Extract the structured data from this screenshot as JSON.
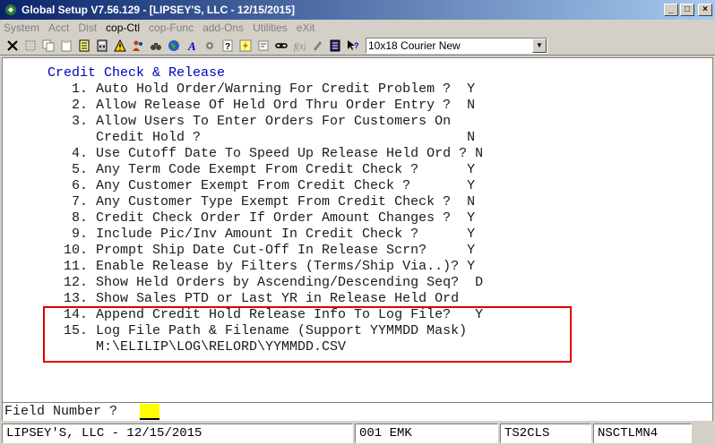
{
  "window": {
    "title": "Global Setup V7.56.129 - [LIPSEY'S, LLC - 12/15/2015]",
    "minimize": "_",
    "maximize": "□",
    "close": "×"
  },
  "menu": [
    {
      "label": "System",
      "enabled": false
    },
    {
      "label": "Acct",
      "enabled": false
    },
    {
      "label": "Dist",
      "enabled": false
    },
    {
      "label": "cop-Ctl",
      "enabled": true
    },
    {
      "label": "cop-Func",
      "enabled": false
    },
    {
      "label": "add-Ons",
      "enabled": false
    },
    {
      "label": "Utilities",
      "enabled": false
    },
    {
      "label": "eXit",
      "enabled": false
    }
  ],
  "toolbar": {
    "font_select": "10x18 Courier New"
  },
  "screen": {
    "title": "Credit Check & Release",
    "lines": [
      {
        "text": "   1. Auto Hold Order/Warning For Credit Problem ?  Y"
      },
      {
        "text": "   2. Allow Release Of Held Ord Thru Order Entry ?  N"
      },
      {
        "text": "   3. Allow Users To Enter Orders For Customers On"
      },
      {
        "text": "      Credit Hold ?                                 N"
      },
      {
        "text": "   4. Use Cutoff Date To Speed Up Release Held Ord ? N"
      },
      {
        "text": "   5. Any Term Code Exempt From Credit Check ?      Y"
      },
      {
        "text": "   6. Any Customer Exempt From Credit Check ?       Y"
      },
      {
        "text": "   7. Any Customer Type Exempt From Credit Check ?  N"
      },
      {
        "text": "   8. Credit Check Order If Order Amount Changes ?  Y"
      },
      {
        "text": "   9. Include Pic/Inv Amount In Credit Check ?      Y"
      },
      {
        "text": "  10. Prompt Ship Date Cut-Off In Release Scrn?     Y"
      },
      {
        "text": "  11. Enable Release by Filters (Terms/Ship Via..)? Y"
      },
      {
        "text": "  12. Show Held Orders by Ascending/Descending Seq?  D"
      },
      {
        "text": "  13. Show Sales PTD or Last YR in Release Held Ord"
      },
      {
        "text": "  14. Append Credit Hold Release Info To Log File?   Y"
      },
      {
        "text": "  15. Log File Path & Filename (Support YYMMDD Mask)"
      },
      {
        "text": "      M:\\ELILIP\\LOG\\RELORD\\YYMMDD.CSV"
      }
    ]
  },
  "field_prompt": "Field Number ?",
  "status": {
    "company": "LIPSEY'S, LLC - 12/15/2015",
    "user": "001 EMK",
    "terminal": "TS2CLS",
    "program": "NSCTLMN4"
  }
}
